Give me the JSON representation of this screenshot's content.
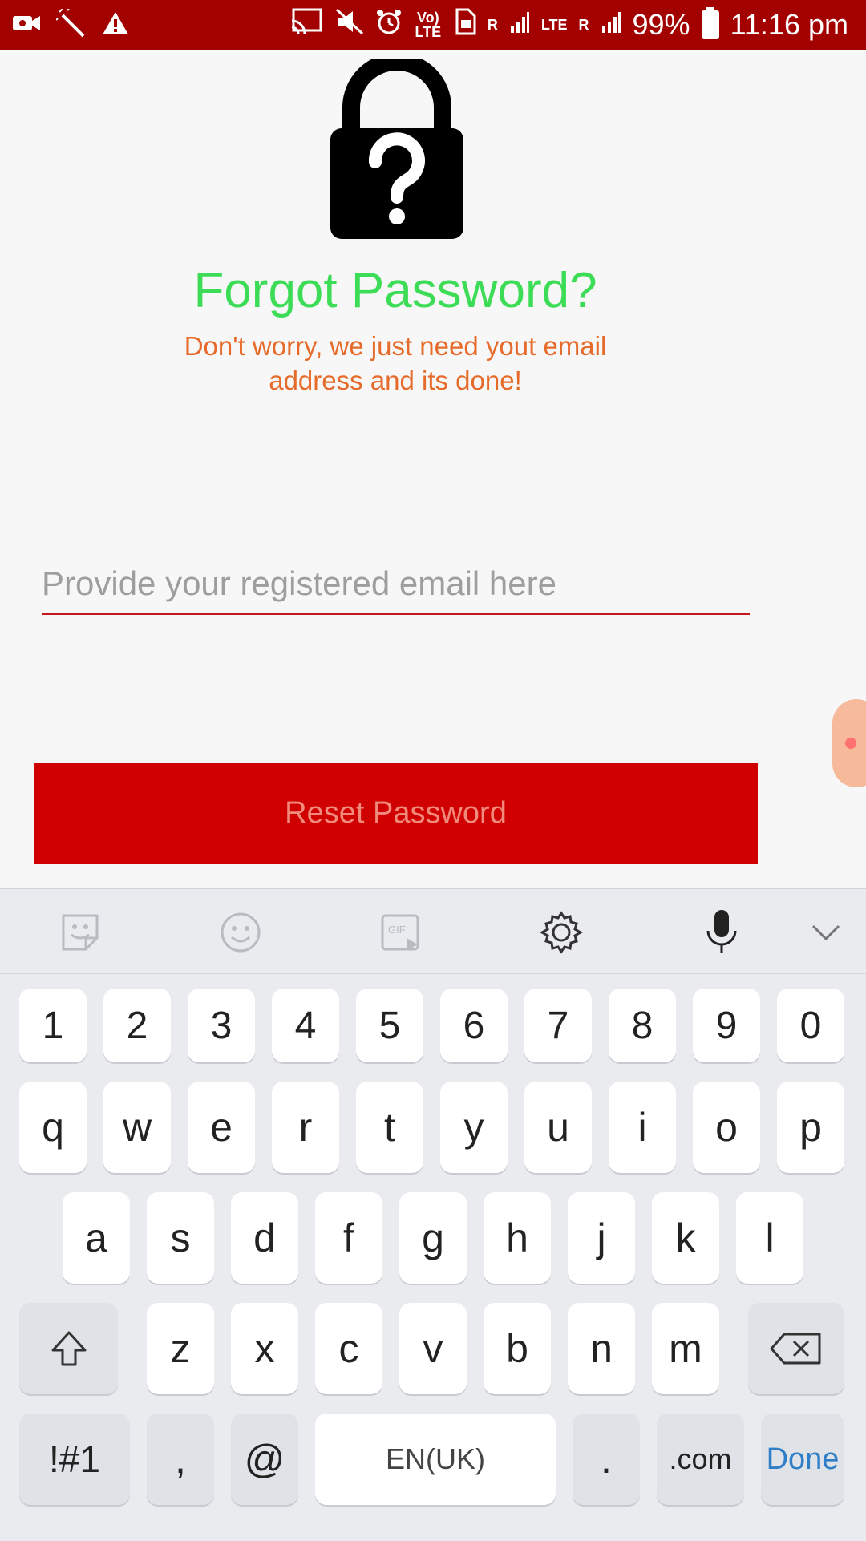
{
  "status_bar": {
    "volte": "Vo) LTE",
    "lte": "LTE",
    "r1": "R",
    "r2": "R",
    "battery": "99%",
    "time": "11:16 pm"
  },
  "app": {
    "title": "Forgot Password?",
    "subtitle": "Don't worry, we just need yout email address and its done!",
    "email_placeholder": "Provide your registered email here",
    "email_value": "",
    "reset_label": "Reset Password",
    "colors": {
      "title": "#3ddc57",
      "subtitle": "#e66b2a",
      "button": "#d10000",
      "status_bar": "#a30000"
    }
  },
  "keyboard": {
    "toolbar": {
      "gif_label": "GIF"
    },
    "row_numbers": [
      "1",
      "2",
      "3",
      "4",
      "5",
      "6",
      "7",
      "8",
      "9",
      "0"
    ],
    "row_q": [
      "q",
      "w",
      "e",
      "r",
      "t",
      "y",
      "u",
      "i",
      "o",
      "p"
    ],
    "row_a": [
      "a",
      "s",
      "d",
      "f",
      "g",
      "h",
      "j",
      "k",
      "l"
    ],
    "row_z": [
      "z",
      "x",
      "c",
      "v",
      "b",
      "n",
      "m"
    ],
    "bottom": {
      "symbols": "!#1",
      "comma": ",",
      "at": "@",
      "space": "EN(UK)",
      "period": ".",
      "dotcom": ".com",
      "done": "Done"
    }
  }
}
